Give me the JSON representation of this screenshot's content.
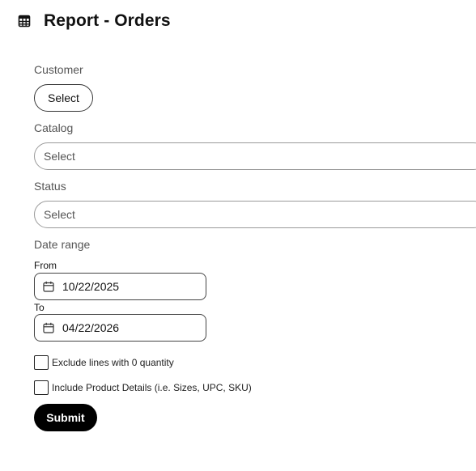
{
  "header": {
    "title": "Report - Orders",
    "icon": "table-icon"
  },
  "customer": {
    "label": "Customer",
    "button_label": "Select"
  },
  "catalog": {
    "label": "Catalog",
    "placeholder": "Select"
  },
  "status": {
    "label": "Status",
    "placeholder": "Select"
  },
  "date_range": {
    "label": "Date range",
    "from_label": "From",
    "from_value": "10/22/2025",
    "to_label": "To",
    "to_value": "04/22/2026"
  },
  "options": {
    "exclude_zero": {
      "label": "Exclude lines with 0 quantity",
      "checked": false
    },
    "include_details": {
      "label": "Include Product Details (i.e. Sizes, UPC, SKU)",
      "checked": false
    }
  },
  "submit_label": "Submit"
}
